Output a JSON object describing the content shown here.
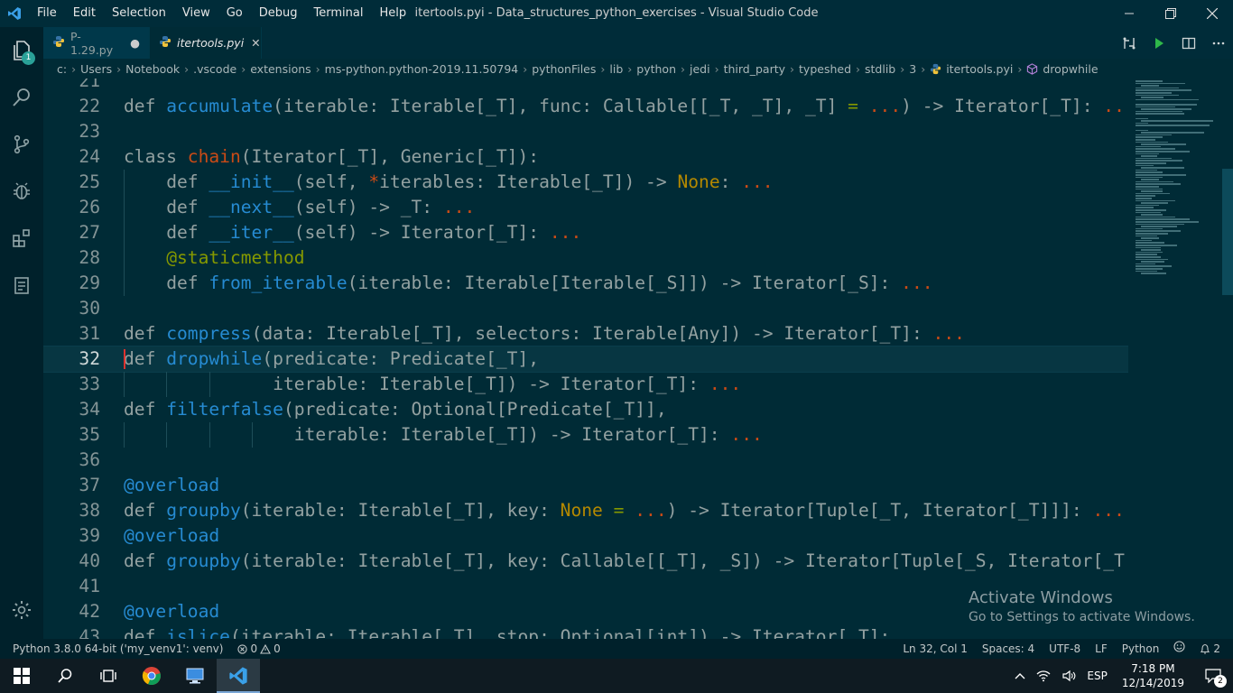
{
  "titlebar": {
    "menus": [
      "File",
      "Edit",
      "Selection",
      "View",
      "Go",
      "Debug",
      "Terminal",
      "Help"
    ],
    "title": "itertools.pyi - Data_structures_python_exercises - Visual Studio Code"
  },
  "activity": {
    "explorer_badge": "1"
  },
  "tabs": [
    {
      "label": "P-1.29.py",
      "dirty_marker": "●"
    },
    {
      "label": "itertools.pyi",
      "close": "✕"
    }
  ],
  "breadcrumbs": [
    "c:",
    "Users",
    "Notebook",
    ".vscode",
    "extensions",
    "ms-python.python-2019.11.50794",
    "pythonFiles",
    "lib",
    "python",
    "jedi",
    "third_party",
    "typeshed",
    "stdlib",
    "3",
    "itertools.pyi",
    "dropwhile"
  ],
  "editor": {
    "lines": [
      {
        "n": "21",
        "text": ""
      },
      {
        "n": "22",
        "text": "def accumulate(iterable: Iterable[_T], func: Callable[[_T, _T], _T] = ...) -> Iterator[_T]: ..."
      },
      {
        "n": "23",
        "text": ""
      },
      {
        "n": "24",
        "text": "class chain(Iterator[_T], Generic[_T]):"
      },
      {
        "n": "25",
        "text": "    def __init__(self, *iterables: Iterable[_T]) -> None: ..."
      },
      {
        "n": "26",
        "text": "    def __next__(self) -> _T: ..."
      },
      {
        "n": "27",
        "text": "    def __iter__(self) -> Iterator[_T]: ..."
      },
      {
        "n": "28",
        "text": "    @staticmethod"
      },
      {
        "n": "29",
        "text": "    def from_iterable(iterable: Iterable[Iterable[_S]]) -> Iterator[_S]: ..."
      },
      {
        "n": "30",
        "text": ""
      },
      {
        "n": "31",
        "text": "def compress(data: Iterable[_T], selectors: Iterable[Any]) -> Iterator[_T]: ..."
      },
      {
        "n": "32",
        "text": "def dropwhile(predicate: Predicate[_T],"
      },
      {
        "n": "33",
        "text": "              iterable: Iterable[_T]) -> Iterator[_T]: ..."
      },
      {
        "n": "34",
        "text": "def filterfalse(predicate: Optional[Predicate[_T]],"
      },
      {
        "n": "35",
        "text": "                iterable: Iterable[_T]) -> Iterator[_T]: ..."
      },
      {
        "n": "36",
        "text": ""
      },
      {
        "n": "37",
        "text": "@overload"
      },
      {
        "n": "38",
        "text": "def groupby(iterable: Iterable[_T], key: None = ...) -> Iterator[Tuple[_T, Iterator[_T]]]: ..."
      },
      {
        "n": "39",
        "text": "@overload"
      },
      {
        "n": "40",
        "text": "def groupby(iterable: Iterable[_T], key: Callable[[_T], _S]) -> Iterator[Tuple[_S, Iterator[_T"
      },
      {
        "n": "41",
        "text": ""
      },
      {
        "n": "42",
        "text": "@overload"
      },
      {
        "n": "43",
        "text": "def islice(iterable: Iterable[_T], stop: Optional[int]) -> Iterator[_T]: ..."
      }
    ],
    "current_line": "32"
  },
  "watermark": {
    "title": "Activate Windows",
    "subtitle": "Go to Settings to activate Windows."
  },
  "statusbar": {
    "interpreter": "Python 3.8.0 64-bit ('my_venv1': venv)",
    "errors": "0",
    "warnings": "0",
    "position": "Ln 32, Col 1",
    "spaces": "Spaces: 4",
    "encoding": "UTF-8",
    "eol": "LF",
    "language": "Python",
    "notifications": "2"
  },
  "taskbar": {
    "language": "ESP",
    "time": "7:18 PM",
    "date": "12/14/2019",
    "notification_count": "2"
  },
  "colors": {
    "background": "#002b36",
    "keyword": "#93a1a1",
    "function": "#268bd2",
    "class": "#cb4b16",
    "constant": "#b58900"
  }
}
